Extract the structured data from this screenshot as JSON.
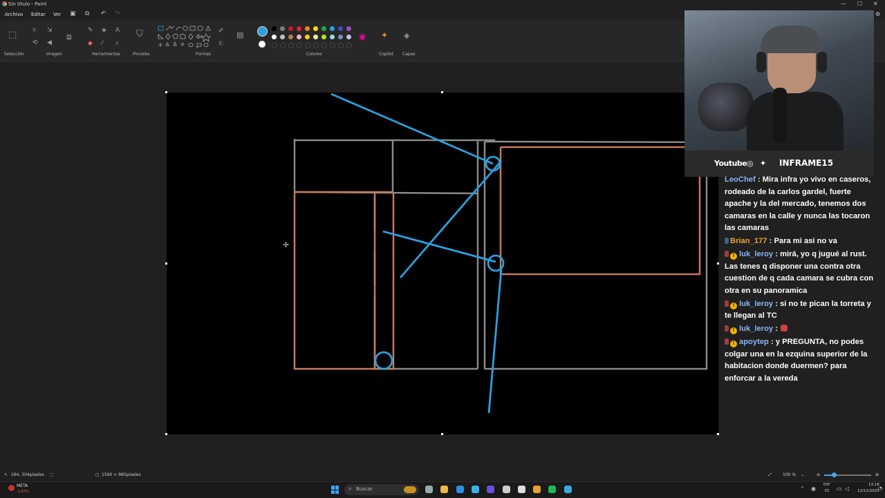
{
  "window": {
    "title": "Sin título - Paint",
    "minimize": "—",
    "maximize": "☐",
    "close": "✕"
  },
  "menu": {
    "file": "Archivo",
    "edit": "Editar",
    "view": "Ver"
  },
  "ribbon": {
    "groups": {
      "selection": "Selección",
      "image": "Imagen",
      "tools": "Herramientas",
      "brushes": "Pinceles",
      "shapes": "Formas",
      "colors": "Colores",
      "copilot": "Copilot",
      "layers": "Capas"
    },
    "active_color": "#2aa0e0",
    "secondary_color": "#ffffff",
    "palette_row1": [
      "#000000",
      "#7f7f7f",
      "#c3192e",
      "#e8212b",
      "#f58024",
      "#fcd520",
      "#23a84a",
      "#1ea7e1",
      "#3a4fc0",
      "#a44ec0"
    ],
    "palette_row2": [
      "#ffffff",
      "#c3c3c3",
      "#b97a57",
      "#ffaec9",
      "#ffc90e",
      "#efe4b0",
      "#b5e61d",
      "#99d9ea",
      "#7092be",
      "#c8bfe7"
    ]
  },
  "status": {
    "cursor_pos": "264, 304píxeles",
    "canvas_size": "1590 × 985píxeles",
    "zoom": "100 %"
  },
  "taskbar": {
    "search_placeholder": "Buscar",
    "stock_label": "META",
    "stock_change": "-1,87%",
    "lang_top": "ESP",
    "lang_bottom": "ES",
    "time": "13:16",
    "date": "12/11/2025"
  },
  "overlay": {
    "youtube": "Youtube",
    "channel": "INFRAME15"
  },
  "chat": [
    {
      "user": "LeoChef",
      "user_color": "#8ab4f8",
      "text": ": Mira infra yo vivo en caseros, rodeado de la carlos gardel, fuerte apache y la del mercado, tenemos dos camaras en la calle y nunca las tocaron las camaras"
    },
    {
      "user": "Brian_177",
      "user_color": "#f0a030",
      "text": ": Para mi asi no va"
    },
    {
      "user": "luk_leroy",
      "user_color": "#8ab4f8",
      "text": ": mirá, yo q jugué al rust. Las tenes q disponer una contra otra cuestion de q cada camara se cubra con otra en su panoramica"
    },
    {
      "user": "luk_leroy",
      "user_color": "#8ab4f8",
      "text": ": si no te pican la torreta y te llegan al TC"
    },
    {
      "user": "luk_leroy",
      "user_color": "#8ab4f8",
      "text": ":"
    },
    {
      "user": "apoytep",
      "user_color": "#8ab4f8",
      "text": ": y PREGUNTA, no podes colgar una en la ezquina superior de la habitacion donde duermen? para enforcar a la vereda"
    }
  ]
}
